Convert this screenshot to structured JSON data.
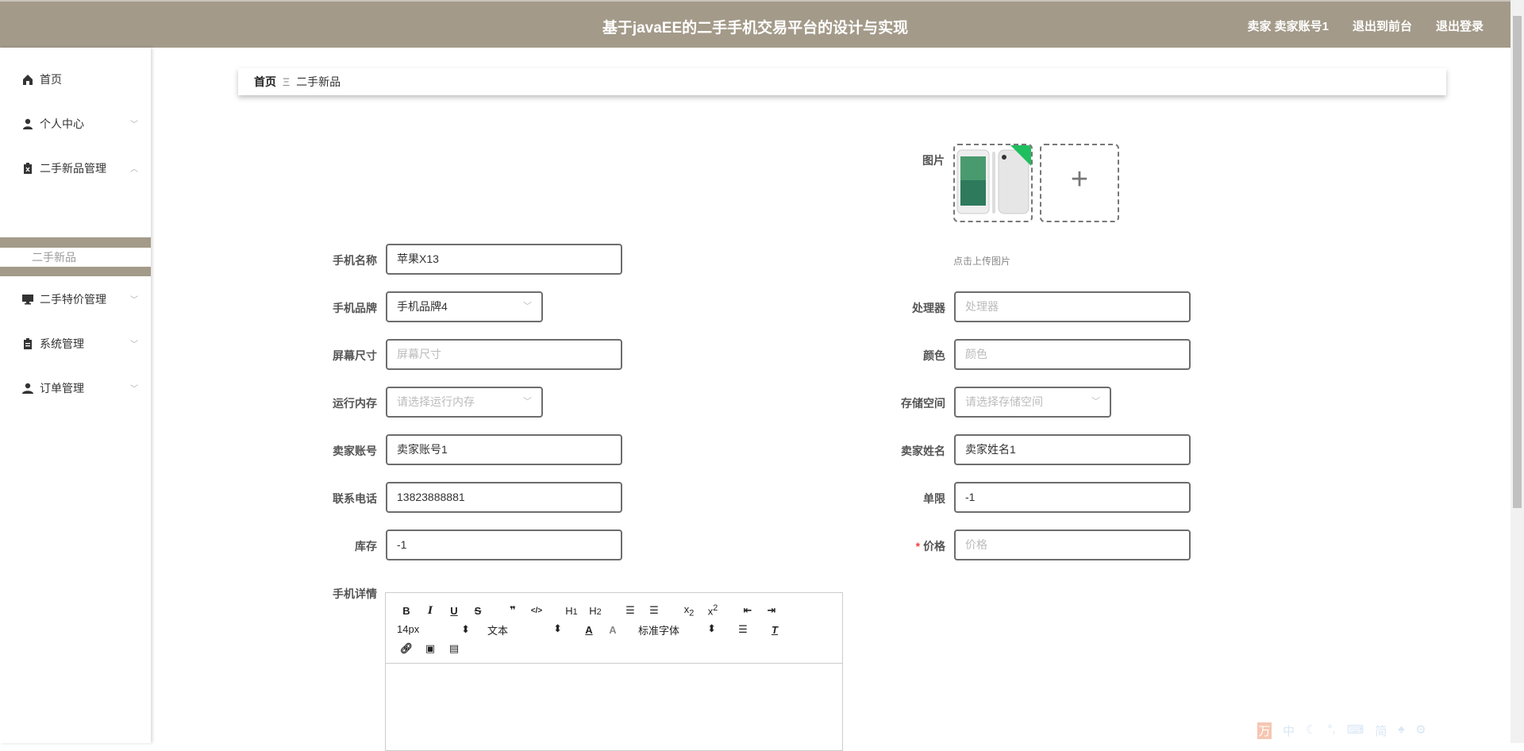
{
  "header": {
    "title": "基于javaEE的二手手机交易平台的设计与实现",
    "user": "卖家 卖家账号1",
    "to_front": "退出到前台",
    "logout": "退出登录"
  },
  "sidebar": {
    "items": [
      {
        "label": "首页",
        "icon": "home-icon"
      },
      {
        "label": "个人中心",
        "icon": "user-icon"
      },
      {
        "label": "二手新品管理",
        "icon": "clipboard-x-icon",
        "expanded": true
      },
      {
        "label": "二手特价管理",
        "icon": "monitor-icon"
      },
      {
        "label": "系统管理",
        "icon": "clipboard-icon"
      },
      {
        "label": "订单管理",
        "icon": "users-icon"
      }
    ],
    "subitem": "二手新品"
  },
  "breadcrumb": {
    "home": "首页",
    "separator": "Ξ",
    "current": "二手新品"
  },
  "form": {
    "image_label": "图片",
    "upload_hint": "点击上传图片",
    "name": {
      "label": "手机名称",
      "value": "苹果X13"
    },
    "brand": {
      "label": "手机品牌",
      "value": "手机品牌4"
    },
    "screen": {
      "label": "屏幕尺寸",
      "placeholder": "屏幕尺寸"
    },
    "ram": {
      "label": "运行内存",
      "placeholder": "请选择运行内存"
    },
    "seller_account": {
      "label": "卖家账号",
      "value": "卖家账号1"
    },
    "phone": {
      "label": "联系电话",
      "value": "13823888881"
    },
    "stock": {
      "label": "库存",
      "value": "-1"
    },
    "cpu": {
      "label": "处理器",
      "placeholder": "处理器"
    },
    "color": {
      "label": "颜色",
      "placeholder": "颜色"
    },
    "storage": {
      "label": "存储空间",
      "placeholder": "请选择存储空间"
    },
    "seller_name": {
      "label": "卖家姓名",
      "value": "卖家姓名1"
    },
    "limit": {
      "label": "单限",
      "value": "-1"
    },
    "price": {
      "label": "价格",
      "required": "*",
      "placeholder": "价格"
    },
    "details_label": "手机详情"
  },
  "editor": {
    "font_size": "14px",
    "format": "文本",
    "font": "标准字体"
  },
  "ime": {
    "lang": "中",
    "mode": "简"
  }
}
